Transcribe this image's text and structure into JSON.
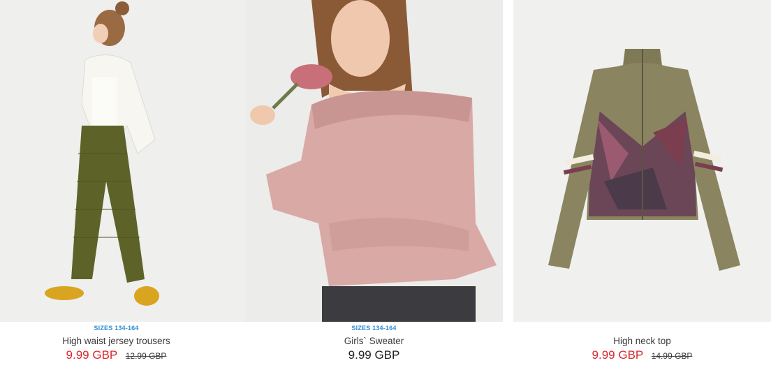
{
  "products": [
    {
      "sizes": "SIZES 134-164",
      "name": "High waist jersey trousers",
      "price": "9.99 GBP",
      "old_price": "12.99 GBP"
    },
    {
      "sizes": "SIZES 134-164",
      "name": "Girls` Sweater",
      "price": "9.99 GBP",
      "old_price": ""
    },
    {
      "sizes": "",
      "name": "High neck top",
      "price": "9.99 GBP",
      "old_price": "14.99 GBP"
    }
  ],
  "colors": {
    "sale_price": "#d8282f",
    "sizes_label": "#2f8fd4",
    "photo_bg": "#eeeeec"
  }
}
